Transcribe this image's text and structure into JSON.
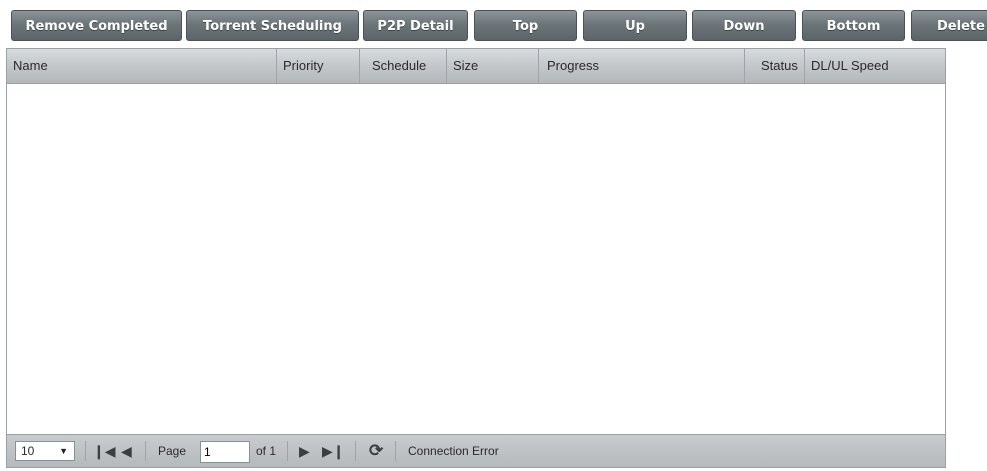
{
  "toolbar": {
    "remove_completed": "Remove Completed",
    "torrent_scheduling": "Torrent Scheduling",
    "p2p_detail": "P2P Detail",
    "top": "Top",
    "up": "Up",
    "down": "Down",
    "bottom": "Bottom",
    "delete": "Delete"
  },
  "grid": {
    "columns": [
      "Name",
      "Priority",
      "Schedule",
      "Size",
      "Progress",
      "Status",
      "DL/UL Speed"
    ],
    "rows": []
  },
  "pager": {
    "page_size": "10",
    "page_label": "Page",
    "page_value": "1",
    "of_label": "of 1",
    "status": "Connection Error"
  }
}
